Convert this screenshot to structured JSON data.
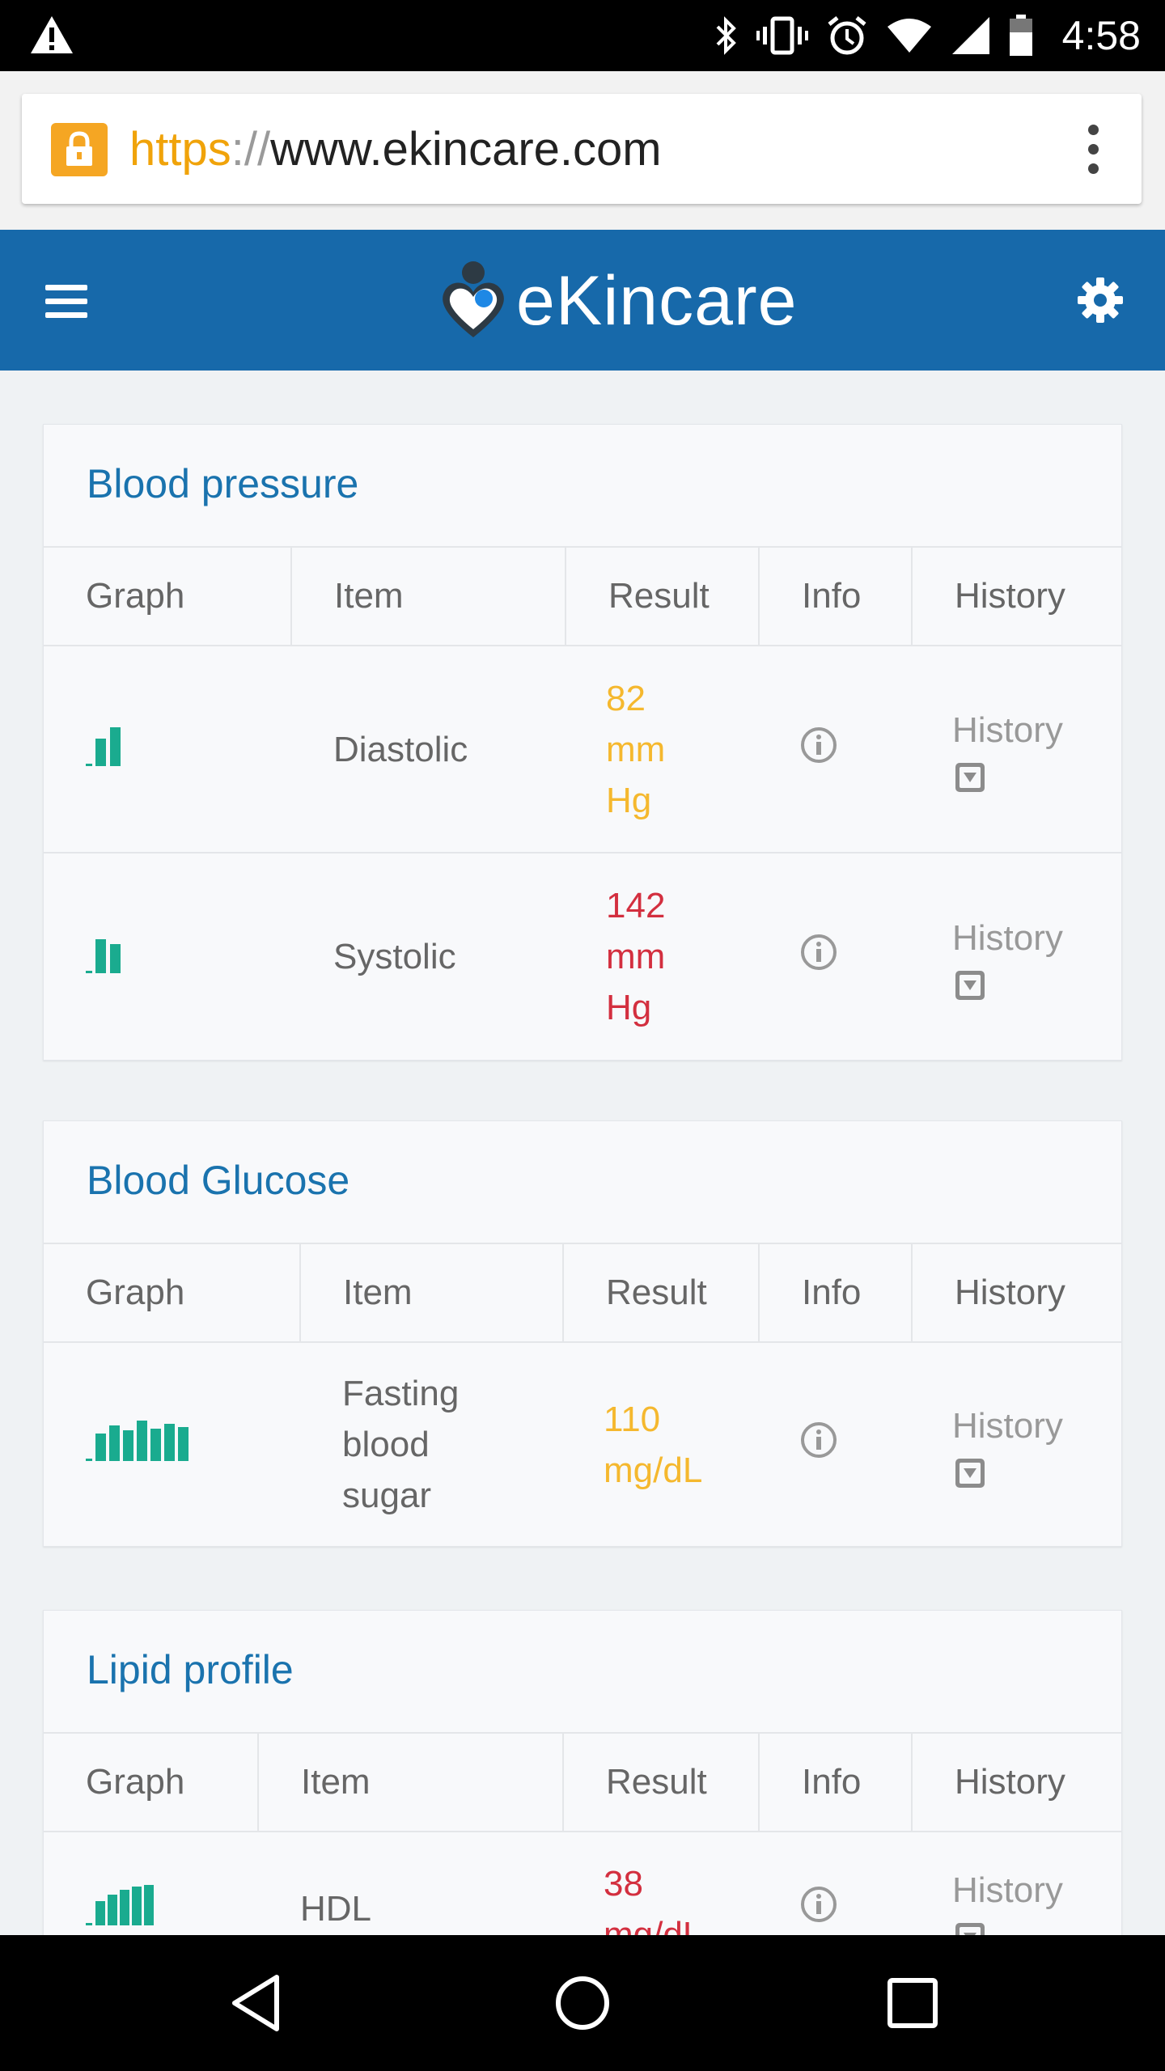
{
  "status_bar": {
    "time": "4:58",
    "icons": [
      "warning-icon",
      "bluetooth-icon",
      "vibrate-icon",
      "alarm-icon",
      "wifi-icon",
      "signal-icon",
      "battery-icon"
    ]
  },
  "browser": {
    "url_scheme": "https",
    "url_sep": "://",
    "url_host": "www.ekincare.com",
    "lock_color": "#f5a623"
  },
  "header": {
    "brand": "eKincare",
    "bg_color": "#1769aa",
    "menu_icon": "hamburger-icon",
    "settings_icon": "gear-icon"
  },
  "columns": {
    "graph": "Graph",
    "item": "Item",
    "result": "Result",
    "info": "Info",
    "history": "History"
  },
  "cards": [
    {
      "title": "Blood pressure",
      "rows": [
        {
          "item": "Diastolic",
          "result_line1": "82",
          "result_line2": "mm",
          "result_line3": "Hg",
          "status": "amber",
          "history": "History"
        },
        {
          "item": "Systolic",
          "result_line1": "142",
          "result_line2": "mm",
          "result_line3": "Hg",
          "status": "red",
          "history": "History"
        }
      ]
    },
    {
      "title": "Blood Glucose",
      "rows": [
        {
          "item_line1": "Fasting",
          "item_line2": "blood",
          "item_line3": "sugar",
          "result_line1": "110",
          "result_line2": "mg/dL",
          "status": "amber",
          "history": "History"
        }
      ]
    },
    {
      "title": "Lipid profile",
      "rows": [
        {
          "item": "HDL",
          "result_line1": "38",
          "result_line2": "mg/dL",
          "status": "red",
          "history": "History"
        }
      ]
    }
  ],
  "colors": {
    "accent_title": "#1a73ae",
    "amber": "#f5b82e",
    "red": "#d32f3f",
    "graph_teal": "#1aab8f"
  },
  "nav_bar": {
    "icons": [
      "back-icon",
      "home-icon",
      "recents-icon"
    ]
  }
}
